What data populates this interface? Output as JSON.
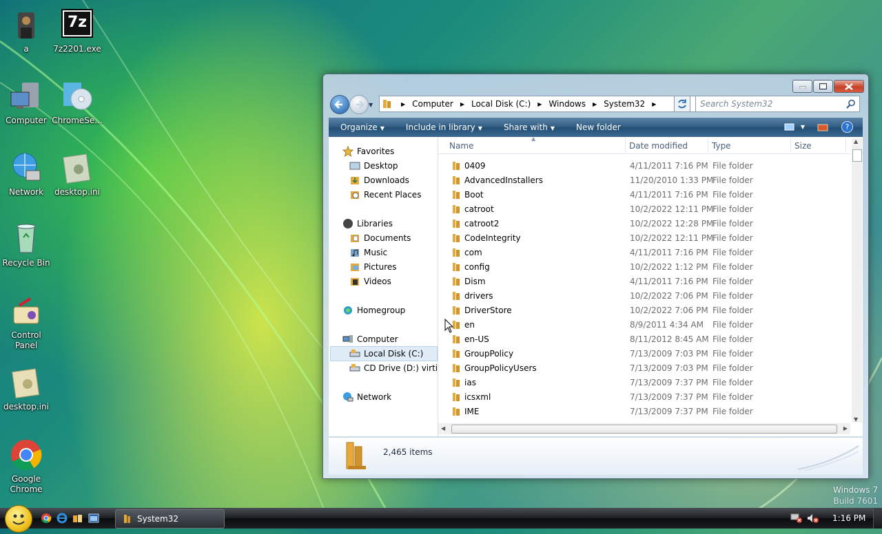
{
  "desktop": {
    "icons": [
      {
        "label": "a"
      },
      {
        "label": "7z2201.exe"
      },
      {
        "label": "Computer"
      },
      {
        "label": "ChromeSe..."
      },
      {
        "label": "Network"
      },
      {
        "label": "desktop.ini"
      },
      {
        "label": "Recycle Bin"
      },
      {
        "label": "Control Panel"
      },
      {
        "label": "desktop.ini"
      },
      {
        "label": "Google Chrome"
      }
    ],
    "sevenzip_glyph": "7z",
    "watermark": {
      "line1": "Windows 7",
      "line2": "Build 7601"
    }
  },
  "explorer": {
    "address": {
      "crumbs": [
        "Computer",
        "Local Disk (C:)",
        "Windows",
        "System32"
      ]
    },
    "search": {
      "placeholder": "Search System32"
    },
    "toolbar": {
      "organize": "Organize",
      "include": "Include in library",
      "share": "Share with",
      "new_folder": "New folder"
    },
    "nav": {
      "favorites": "Favorites",
      "desktop": "Desktop",
      "downloads": "Downloads",
      "recent": "Recent Places",
      "libraries": "Libraries",
      "documents": "Documents",
      "music": "Music",
      "pictures": "Pictures",
      "videos": "Videos",
      "homegroup": "Homegroup",
      "computer": "Computer",
      "local_disk": "Local Disk (C:)",
      "cd_drive": "CD Drive (D:) virtio-w",
      "network": "Network"
    },
    "columns": {
      "name": "Name",
      "date": "Date modified",
      "type": "Type",
      "size": "Size"
    },
    "files": [
      {
        "name": "0409",
        "date": "4/11/2011 7:16 PM",
        "type": "File folder"
      },
      {
        "name": "AdvancedInstallers",
        "date": "11/20/2010 1:33 PM",
        "type": "File folder"
      },
      {
        "name": "Boot",
        "date": "4/11/2011 7:16 PM",
        "type": "File folder"
      },
      {
        "name": "catroot",
        "date": "10/2/2022 12:11 PM",
        "type": "File folder"
      },
      {
        "name": "catroot2",
        "date": "10/2/2022 12:28 PM",
        "type": "File folder"
      },
      {
        "name": "CodeIntegrity",
        "date": "10/2/2022 12:11 PM",
        "type": "File folder"
      },
      {
        "name": "com",
        "date": "4/11/2011 7:16 PM",
        "type": "File folder"
      },
      {
        "name": "config",
        "date": "10/2/2022 1:12 PM",
        "type": "File folder"
      },
      {
        "name": "Dism",
        "date": "4/11/2011 7:16 PM",
        "type": "File folder"
      },
      {
        "name": "drivers",
        "date": "10/2/2022 7:06 PM",
        "type": "File folder"
      },
      {
        "name": "DriverStore",
        "date": "10/2/2022 7:06 PM",
        "type": "File folder"
      },
      {
        "name": "en",
        "date": "8/9/2011 4:34 AM",
        "type": "File folder"
      },
      {
        "name": "en-US",
        "date": "8/11/2012 8:45 AM",
        "type": "File folder"
      },
      {
        "name": "GroupPolicy",
        "date": "7/13/2009 7:03 PM",
        "type": "File folder"
      },
      {
        "name": "GroupPolicyUsers",
        "date": "7/13/2009 7:03 PM",
        "type": "File folder"
      },
      {
        "name": "ias",
        "date": "7/13/2009 7:37 PM",
        "type": "File folder"
      },
      {
        "name": "icsxml",
        "date": "7/13/2009 7:37 PM",
        "type": "File folder"
      },
      {
        "name": "IME",
        "date": "7/13/2009 7:37 PM",
        "type": "File folder"
      }
    ],
    "status": {
      "count": "2,465 items"
    }
  },
  "taskbar": {
    "window_label": "System32",
    "clock": "1:16 PM"
  },
  "colors": {
    "accent": "#2f5a80",
    "selection": "#dfebf7",
    "folder": "#e7a93a"
  }
}
